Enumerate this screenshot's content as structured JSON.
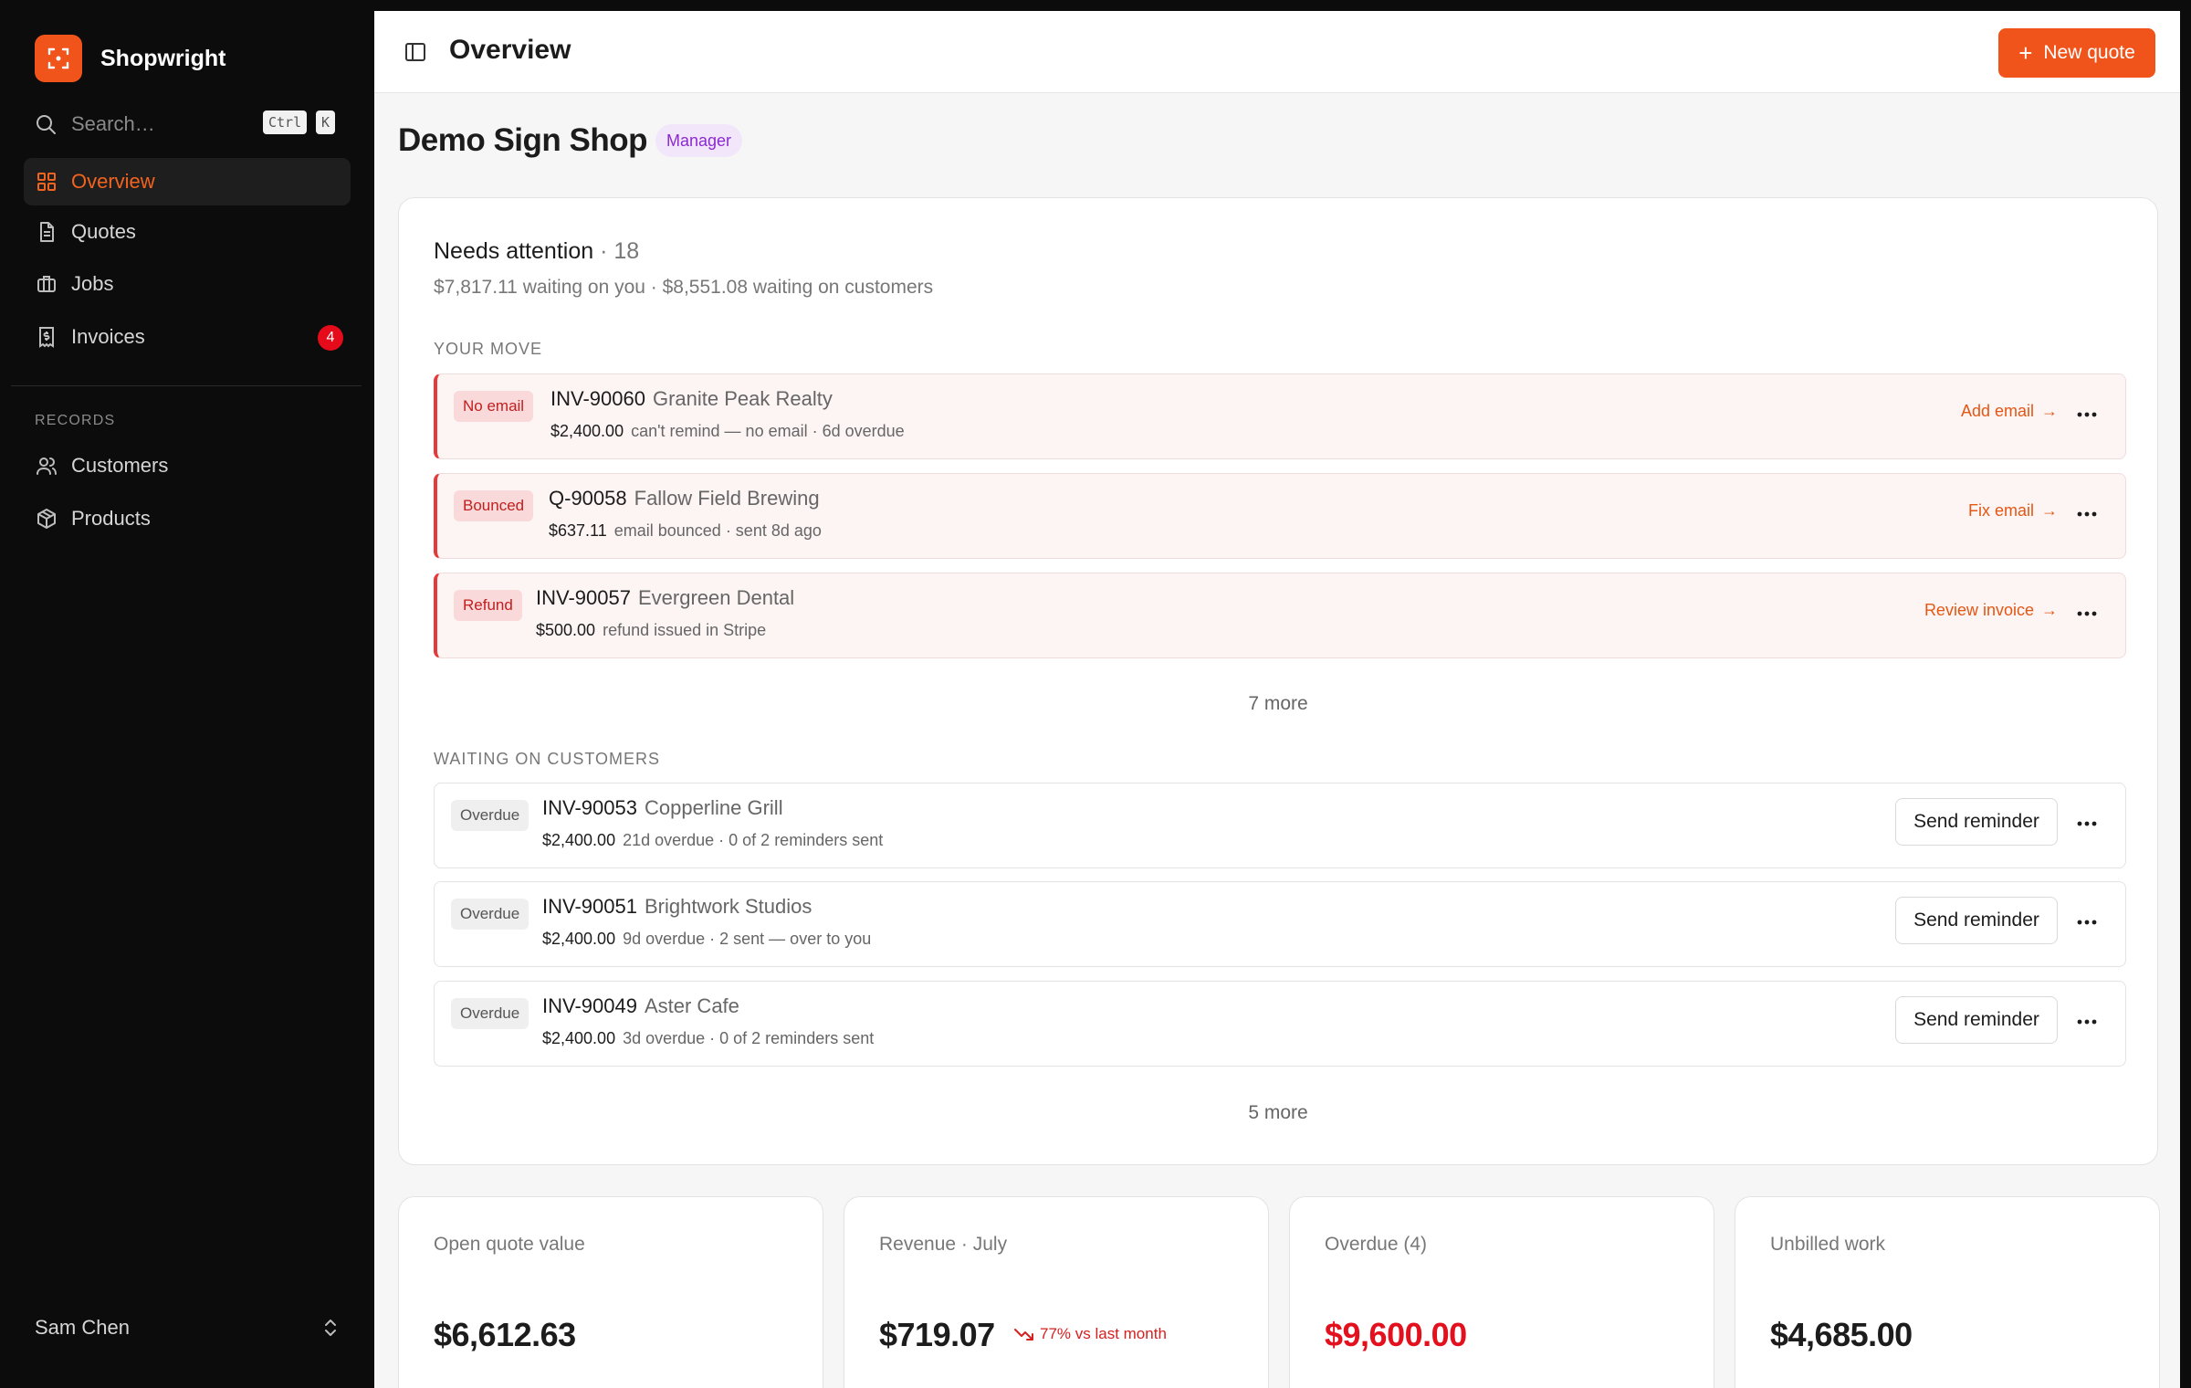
{
  "brand": {
    "name": "Shopwright",
    "accent": "#f0541b"
  },
  "search": {
    "placeholder": "Search…",
    "shortcut_ctrl": "Ctrl",
    "shortcut_key": "K"
  },
  "nav": [
    {
      "label": "Overview",
      "icon": "grid-icon",
      "active": true
    },
    {
      "label": "Quotes",
      "icon": "document-icon"
    },
    {
      "label": "Jobs",
      "icon": "briefcase-icon"
    },
    {
      "label": "Invoices",
      "icon": "receipt-icon",
      "badge": "4"
    }
  ],
  "records": {
    "label": "RECORDS",
    "items": [
      {
        "label": "Customers",
        "icon": "users-icon"
      },
      {
        "label": "Products",
        "icon": "box-icon"
      }
    ]
  },
  "user": {
    "name": "Sam Chen"
  },
  "topbar": {
    "title": "Overview",
    "new_quote_label": "New quote"
  },
  "page": {
    "title": "Demo Sign Shop",
    "role": "Manager"
  },
  "attention": {
    "title": "Needs attention",
    "count": "· 18",
    "summary": "$7,817.11 waiting on you · $8,551.08 waiting on customers",
    "your_move": {
      "label": "YOUR MOVE",
      "rows": [
        {
          "tag": "No email",
          "id": "INV-90060",
          "customer": "Granite Peak Realty",
          "amount": "$2,400.00",
          "detail": "can't remind — no email  · 6d overdue",
          "action": "Add email"
        },
        {
          "tag": "Bounced",
          "id": "Q-90058",
          "customer": "Fallow Field Brewing",
          "amount": "$637.11",
          "detail": "email bounced  · sent 8d ago",
          "action": "Fix email"
        },
        {
          "tag": "Refund",
          "id": "INV-90057",
          "customer": "Evergreen Dental",
          "amount": "$500.00",
          "detail": "refund issued in Stripe",
          "action": "Review invoice"
        }
      ],
      "more": "7 more"
    },
    "waiting": {
      "label": "WAITING ON CUSTOMERS",
      "rows": [
        {
          "tag": "Overdue",
          "id": "INV-90053",
          "customer": "Copperline Grill",
          "amount": "$2,400.00",
          "detail": "21d overdue  · 0 of 2 reminders sent",
          "action": "Send reminder"
        },
        {
          "tag": "Overdue",
          "id": "INV-90051",
          "customer": "Brightwork Studios",
          "amount": "$2,400.00",
          "detail": "9d overdue  · 2 sent — over to you",
          "action": "Send reminder"
        },
        {
          "tag": "Overdue",
          "id": "INV-90049",
          "customer": "Aster Cafe",
          "amount": "$2,400.00",
          "detail": "3d overdue  · 0 of 2 reminders sent",
          "action": "Send reminder"
        }
      ],
      "more": "5 more"
    }
  },
  "stats": [
    {
      "label": "Open quote value",
      "value": "$6,612.63"
    },
    {
      "label": "Revenue · July",
      "value": "$719.07",
      "trend": "77% vs last month",
      "trend_color": "#d42020"
    },
    {
      "label": "Overdue (4)",
      "value": "$9,600.00",
      "value_color": "#e3101d"
    },
    {
      "label": "Unbilled work",
      "value": "$4,685.00"
    }
  ]
}
